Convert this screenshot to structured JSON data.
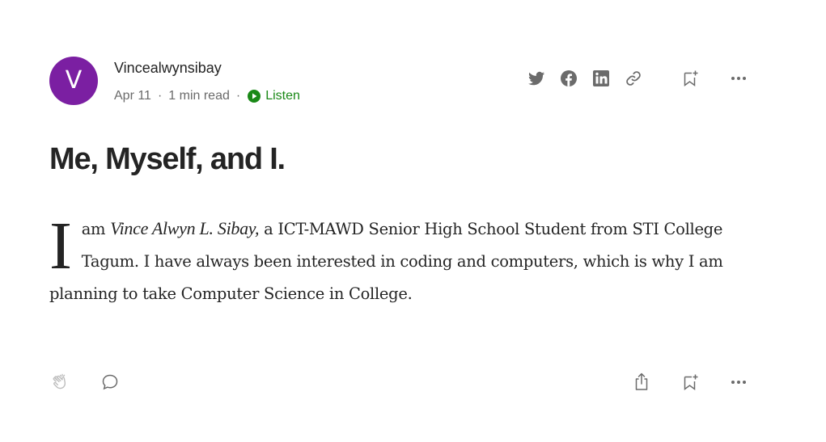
{
  "author": {
    "avatar_letter": "V",
    "avatar_color": "#7b1fa2",
    "name": "Vincealwynsibay"
  },
  "meta": {
    "date": "Apr 11",
    "separator": "·",
    "read_time": "1 min read",
    "listen_label": "Listen",
    "listen_color": "#1a8917"
  },
  "share_icons": [
    "twitter-icon",
    "facebook-icon",
    "linkedin-icon",
    "link-icon",
    "bookmark-add-icon",
    "more-icon"
  ],
  "article": {
    "title": "Me, Myself, and I.",
    "dropcap": "I",
    "text_before_name": " am ",
    "name_italic": "Vince Alwyn L. Sibay,",
    "text_after_name": " a ICT-MAWD Senior High School Student from STI College Tagum. I have always been interested in coding and computers, which is why I am planning to take Computer Science in College."
  },
  "footer_icons": [
    "clap-icon",
    "comment-icon",
    "share-icon",
    "bookmark-add-icon",
    "more-icon"
  ],
  "colors": {
    "text": "#242424",
    "muted": "#6b6b6b",
    "icon": "#6b6b6b"
  }
}
